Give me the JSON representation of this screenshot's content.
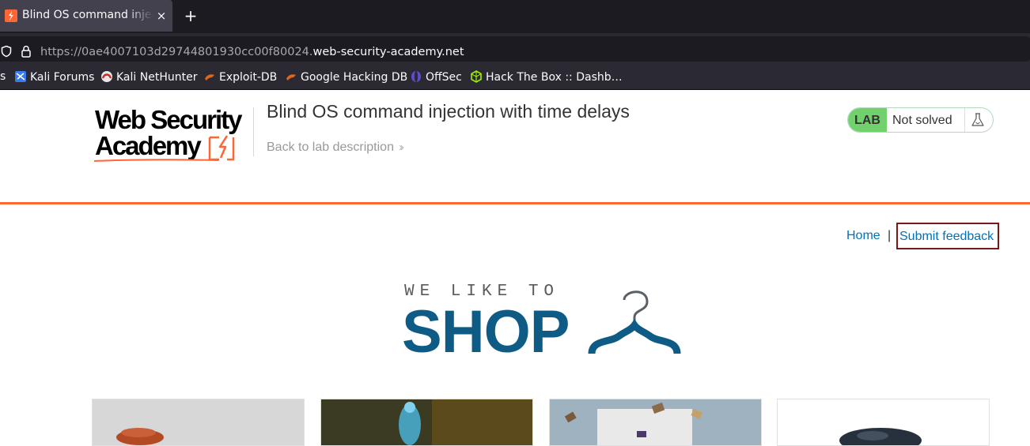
{
  "browser": {
    "tab_title": "Blind OS command injection with time delays",
    "new_tab_symbol": "+",
    "close_symbol": "×",
    "url": {
      "prefix": "https://0ae4007103d29744801930cc00f80024.",
      "domain": "web-security-academy.net"
    },
    "bookmarks": [
      {
        "label": "s"
      },
      {
        "label": "Kali Forums",
        "icon": "kali-icon"
      },
      {
        "label": "Kali NetHunter",
        "icon": "nethunter-icon"
      },
      {
        "label": "Exploit-DB",
        "icon": "exploitdb-icon"
      },
      {
        "label": "Google Hacking DB",
        "icon": "ghdb-icon"
      },
      {
        "label": "OffSec",
        "icon": "offsec-icon"
      },
      {
        "label": "Hack The Box :: Dashb…",
        "icon": "htb-icon"
      }
    ]
  },
  "lab": {
    "logo_line1": "Web Security",
    "logo_line2": "Academy",
    "title": "Blind OS command injection with time delays",
    "back_link": "Back to lab description",
    "badge": "LAB",
    "status": "Not solved",
    "accent_color": "#ff6633",
    "status_color": "#70d16d"
  },
  "nav": {
    "home": "Home",
    "separator": "|",
    "feedback": "Submit feedback"
  },
  "shop": {
    "tagline": "WE LIKE TO",
    "word": "SHOP",
    "brand_color": "#0e5c86"
  }
}
